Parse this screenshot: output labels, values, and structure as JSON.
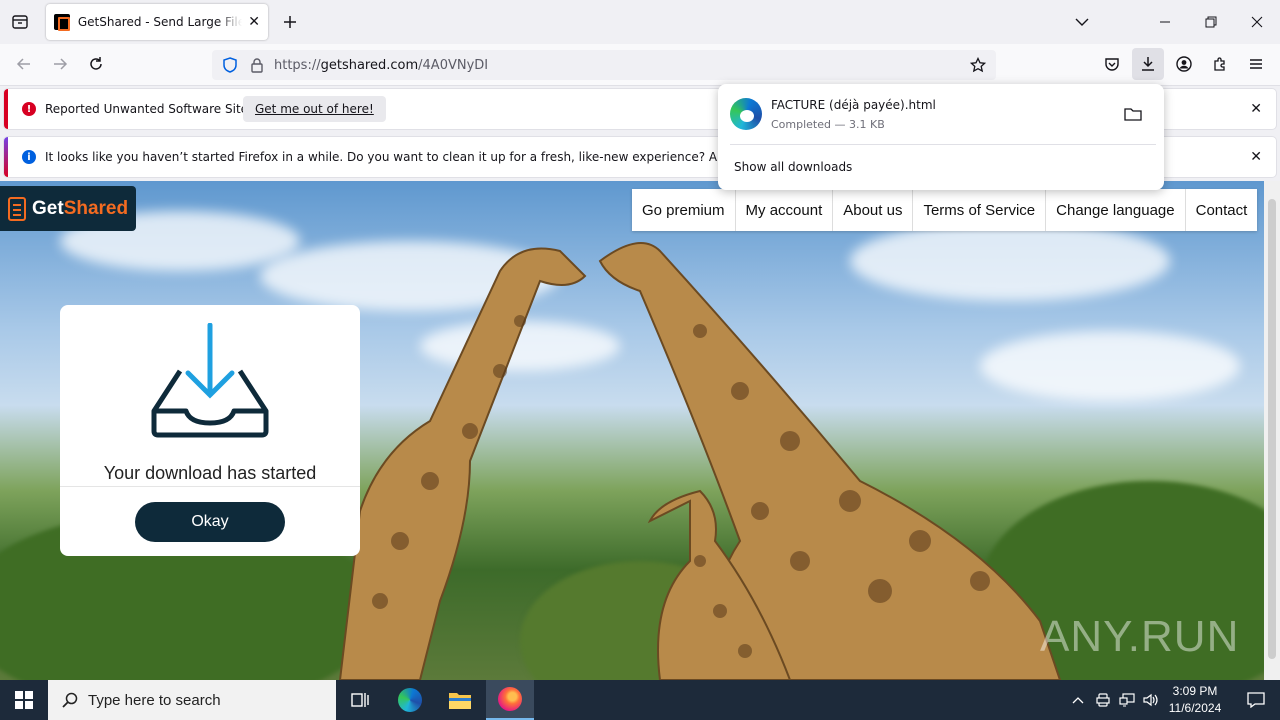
{
  "browser": {
    "tab": {
      "title": "GetShared - Send Large Files and"
    },
    "url": {
      "prefix": "https://",
      "host": "getshared.com",
      "path": "/4A0VNyDI"
    }
  },
  "notifications": [
    {
      "message": "Reported Unwanted Software Site!",
      "action": "Get me out of here!",
      "color": "#d70022"
    },
    {
      "message": "It looks like you haven’t started Firefox in a while. Do you want to clean it up for a fresh, like-new experience? And by the way, welcome back!",
      "color": "#0060df"
    }
  ],
  "downloads_panel": {
    "filename": "FACTURE (déjà payée).html",
    "status": "Completed — 3.1 KB",
    "show_all": "Show all downloads"
  },
  "site": {
    "logo": {
      "part1": "Get",
      "part2": "Shared"
    },
    "nav": [
      "Go premium",
      "My account",
      "About us",
      "Terms of Service",
      "Change language",
      "Contact"
    ],
    "modal": {
      "message": "Your download has started",
      "button": "Okay"
    },
    "watermark": "ANY.RUN"
  },
  "taskbar": {
    "search_placeholder": "Type here to search",
    "time": "3:09 PM",
    "date": "11/6/2024"
  },
  "colors": {
    "accent_orange": "#f36b21",
    "brand_dark": "#0e2a3a",
    "taskbar": "#1d2a3a"
  }
}
